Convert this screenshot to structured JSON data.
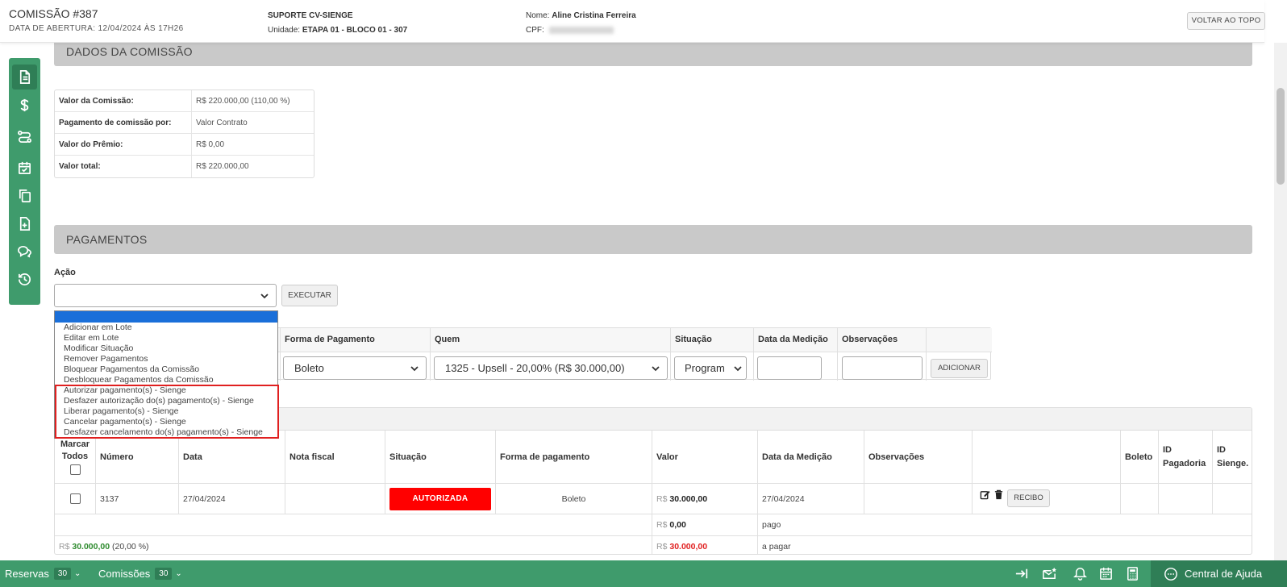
{
  "header": {
    "title": "COMISSÃO #387",
    "opening": "DATA DE ABERTURA: 12/04/2024 ÀS 17H26",
    "company": "SUPORTE CV-SIENGE",
    "unit_label": "Unidade:",
    "unit_value": "ETAPA 01 - BLOCO 01 - 307",
    "name_label": "Nome:",
    "name_value": "Aline Cristina Ferreira",
    "cpf_label": "CPF:",
    "top_button": "VOLTAR AO TOPO"
  },
  "sections": {
    "dados": "DADOS DA COMISSÃO",
    "pagamentos": "PAGAMENTOS"
  },
  "dados": [
    {
      "key": "Valor da Comissão:",
      "value": "R$ 220.000,00 (110,00 %)"
    },
    {
      "key": "Pagamento de comissão por:",
      "value": "Valor Contrato"
    },
    {
      "key": "Valor do Prêmio:",
      "value": "R$ 0,00"
    },
    {
      "key": "Valor total:",
      "value": "R$ 220.000,00"
    }
  ],
  "acao": {
    "label": "Ação",
    "execute": "EXECUTAR",
    "options": [
      "Adicionar em Lote",
      "Editar em Lote",
      "Modificar Situação",
      "Remover Pagamentos",
      "Bloquear Pagamentos da Comissão",
      "Desbloquear Pagamentos da Comissão",
      "Autorizar pagamento(s) - Sienge",
      "Desfazer autorização do(s) pagamento(s) - Sienge",
      "Liberar pagamento(s) - Sienge",
      "Cancelar pagamento(s) - Sienge",
      "Desfazer cancelamento do(s) pagamento(s) - Sienge"
    ]
  },
  "add_form": {
    "headers": {
      "forma": "Forma de Pagamento",
      "quem": "Quem",
      "situacao": "Situação",
      "data": "Data da Medição",
      "obs": "Observações"
    },
    "forma_value": "Boleto",
    "quem_value": "1325 - Upsell - 20,00% (R$ 30.000,00)",
    "situacao_value": "Program",
    "add_button": "ADICIONAR"
  },
  "pay_table": {
    "headers": {
      "marcar": "Marcar Todos",
      "numero": "Número",
      "data": "Data",
      "nota": "Nota fiscal",
      "situacao": "Situação",
      "forma": "Forma de pagamento",
      "valor": "Valor",
      "medicao": "Data da Medição",
      "obs": "Observações",
      "boleto": "Boleto",
      "pagadoria": "ID Pagadoria",
      "sienge": "ID Sienge."
    },
    "row": {
      "numero": "3137",
      "data": "27/04/2024",
      "situacao": "AUTORIZADA",
      "forma": "Boleto",
      "valor_prefix": "R$",
      "valor": "30.000,00",
      "medicao": "27/04/2024",
      "recibo": "RECIBO"
    },
    "pago": {
      "prefix": "R$",
      "value": "0,00",
      "label": "pago"
    },
    "apagar": {
      "left_prefix": "R$",
      "left_value": "30.000,00",
      "left_pct": "(20,00 %)",
      "prefix": "R$",
      "value": "30.000,00",
      "label": "a pagar"
    }
  },
  "bottom": {
    "reservas": "Reservas",
    "reservas_count": "30",
    "comissoes": "Comissões",
    "comissoes_count": "30",
    "help": "Central de Ajuda"
  },
  "colors": {
    "green": "#3f9b6c",
    "dark_green": "#2f7e56",
    "red": "#ff0000"
  }
}
